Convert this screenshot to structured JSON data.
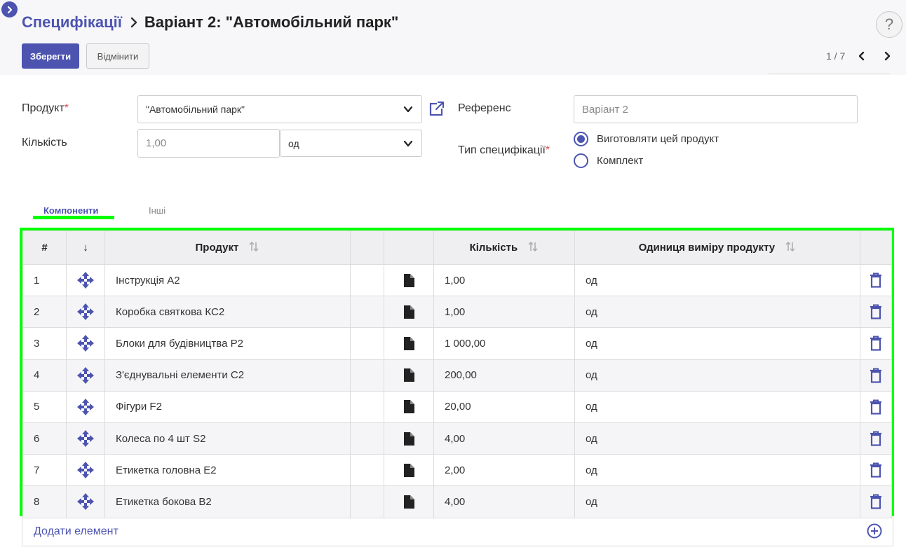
{
  "header": {
    "breadcrumb_parent": "Специфікації",
    "breadcrumb_current": "Варіант 2: \"Автомобільний парк\"",
    "save_label": "Зберегти",
    "cancel_label": "Відмінити",
    "help_label": "?",
    "pager_text": "1 / 7"
  },
  "form": {
    "product_label": "Продукт",
    "product_required_mark": "*",
    "product_value": "\"Автомобільний парк\"",
    "quantity_label": "Кількість",
    "quantity_value": "1,00",
    "uom_value": "од",
    "reference_label": "Референс",
    "reference_value": "Варіант 2",
    "bom_type_label": "Тип специфікації",
    "bom_type_required_mark": "*",
    "bom_type_options": [
      {
        "label": "Виготовляти цей продукт",
        "selected": true
      },
      {
        "label": "Комплект",
        "selected": false
      }
    ]
  },
  "tabs": [
    {
      "label": "Компоненти",
      "active": true
    },
    {
      "label": "Інші",
      "active": false
    }
  ],
  "table": {
    "headers": {
      "index": "#",
      "sequence": "↓",
      "product": "Продукт",
      "quantity": "Кількість",
      "uom": "Одиниця виміру продукту"
    },
    "rows": [
      {
        "index": "1",
        "product": "Інструкція А2",
        "quantity": "1,00",
        "uom": "од"
      },
      {
        "index": "2",
        "product": "Коробка святкова КС2",
        "quantity": "1,00",
        "uom": "од"
      },
      {
        "index": "3",
        "product": "Блоки для будівництва Р2",
        "quantity": "1 000,00",
        "uom": "од"
      },
      {
        "index": "4",
        "product": "З'єднувальні елементи С2",
        "quantity": "200,00",
        "uom": "од"
      },
      {
        "index": "5",
        "product": "Фігури F2",
        "quantity": "20,00",
        "uom": "од"
      },
      {
        "index": "6",
        "product": "Колеса по 4 шт S2",
        "quantity": "4,00",
        "uom": "од"
      },
      {
        "index": "7",
        "product": "Етикетка головна Е2",
        "quantity": "2,00",
        "uom": "од"
      },
      {
        "index": "8",
        "product": "Етикетка бокова В2",
        "quantity": "4,00",
        "uom": "од"
      }
    ],
    "add_label": "Додати елемент"
  },
  "colors": {
    "accent": "#4c54b0",
    "highlight": "#00ff00",
    "required": "#d9534f"
  },
  "icons": [
    "chevron-right-icon",
    "chevron-left-icon",
    "chevron-down-icon",
    "external-link-icon",
    "drag-handle-icon",
    "document-icon",
    "trash-icon",
    "add-circle-icon",
    "sort-icon",
    "help-icon"
  ]
}
